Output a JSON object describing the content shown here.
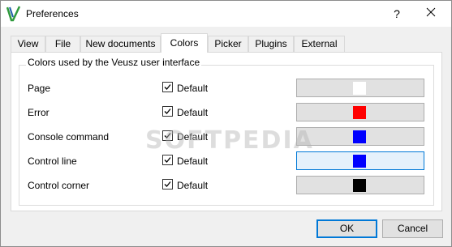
{
  "window": {
    "title": "Preferences",
    "help_glyph": "?",
    "close_glyph": "✕"
  },
  "tabs": [
    {
      "label": "View",
      "active": false
    },
    {
      "label": "File",
      "active": false
    },
    {
      "label": "New documents",
      "active": false
    },
    {
      "label": "Colors",
      "active": true
    },
    {
      "label": "Picker",
      "active": false
    },
    {
      "label": "Plugins",
      "active": false
    },
    {
      "label": "External",
      "active": false
    }
  ],
  "colors_group": {
    "title": "Colors used by the Veusz user interface",
    "checkbox_label": "Default",
    "rows": [
      {
        "label": "Page",
        "default_checked": true,
        "swatch_color": "#ffffff"
      },
      {
        "label": "Error",
        "default_checked": true,
        "swatch_color": "#ff0000"
      },
      {
        "label": "Console command",
        "default_checked": true,
        "swatch_color": "#0000ff"
      },
      {
        "label": "Control line",
        "default_checked": true,
        "swatch_color": "#0000ff"
      },
      {
        "label": "Control corner",
        "default_checked": true,
        "swatch_color": "#000000"
      }
    ]
  },
  "buttons": {
    "ok": "OK",
    "cancel": "Cancel"
  },
  "watermark": "SOFTPEDIA",
  "icons": {
    "app": "veusz-logo-icon",
    "help": "help-icon",
    "close": "close-icon",
    "check": "checkmark-icon"
  }
}
